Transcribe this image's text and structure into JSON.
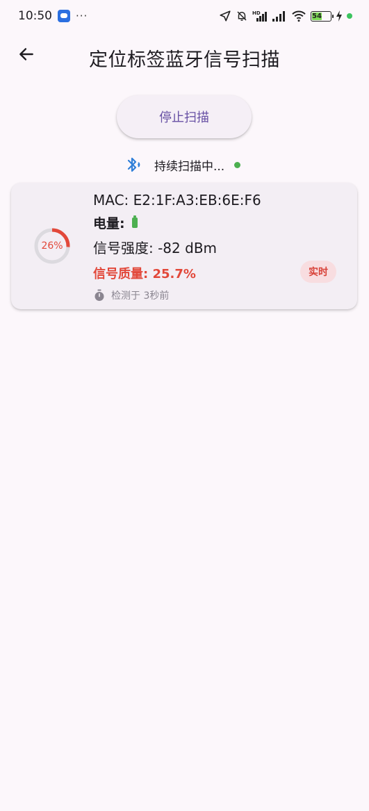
{
  "status_bar": {
    "time": "10:50",
    "overflow": "···",
    "battery_level": "54",
    "battery_fraction": 0.54,
    "icons": [
      "app-notification-icon",
      "location-arrow-icon",
      "bell-muted-icon",
      "hd-signal-icon",
      "signal-icon",
      "wifi-icon",
      "battery-icon",
      "charging-icon"
    ]
  },
  "app_bar": {
    "title": "定位标签蓝牙信号扫描",
    "back_icon": "arrow-back-icon"
  },
  "actions": {
    "stop_label": "停止扫描"
  },
  "scan_status": {
    "text": "持续扫描中...",
    "icon": "bluetooth-searching-icon",
    "indicator_color": "#4caf50"
  },
  "devices": [
    {
      "mac": "MAC: E2:1F:A3:EB:6E:F6",
      "power_label": "电量:",
      "battery_icon": "battery-full-icon",
      "rssi": "信号强度: -82 dBm",
      "quality": "信号质量: 25.7%",
      "gauge_label": "26%",
      "gauge_fraction": 0.26,
      "badge": "实时",
      "detected": "检测于 3秒前"
    }
  ],
  "colors": {
    "background": "#fcf7fb",
    "accent": "#6750a4",
    "weak_signal": "#e2483a",
    "badge_bg": "#f8dde0"
  }
}
